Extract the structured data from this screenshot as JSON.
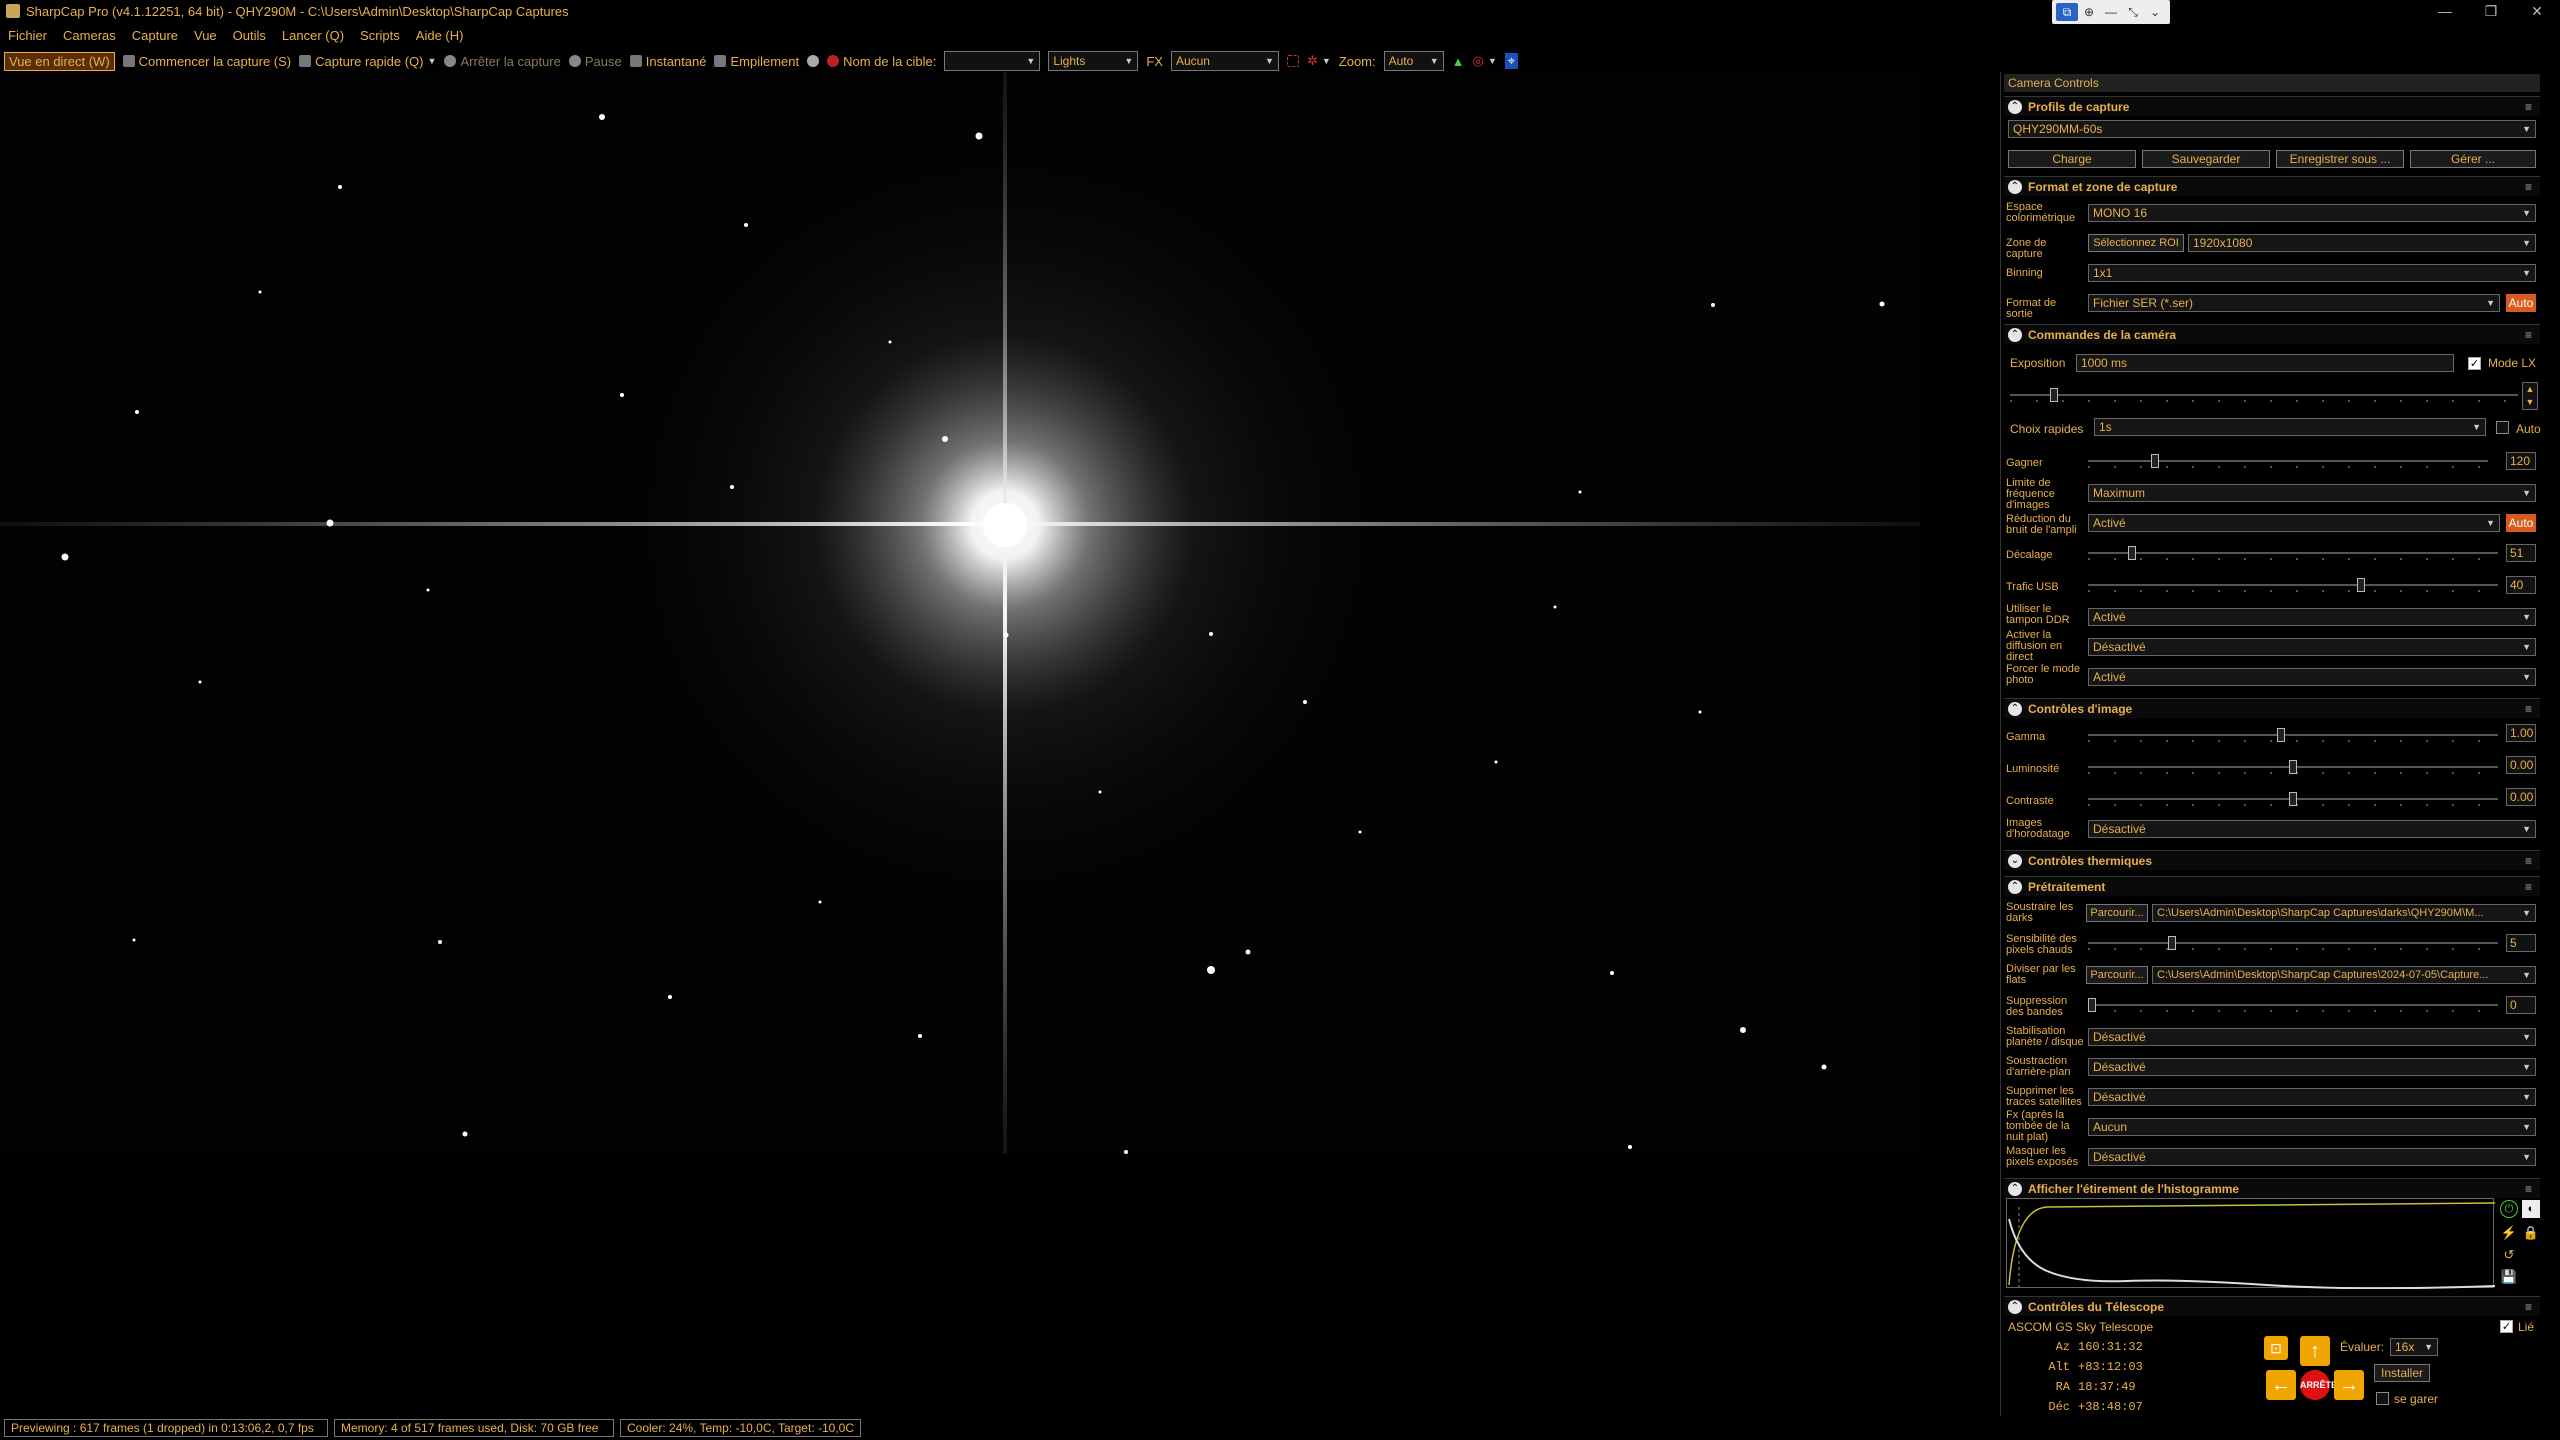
{
  "window": {
    "title": "SharpCap Pro (v4.1.12251, 64 bit) - QHY290M - C:\\Users\\Admin\\Desktop\\SharpCap Captures"
  },
  "menu": [
    "Fichier",
    "Cameras",
    "Capture",
    "Vue",
    "Outils",
    "Lancer (Q)",
    "Scripts",
    "Aide (H)"
  ],
  "toolbar": {
    "live_view": "Vue en direct (W)",
    "start_capture": "Commencer la capture (S)",
    "quick_capture": "Capture rapide (Q)",
    "stop_capture": "Arrêter la capture",
    "pause": "Pause",
    "snapshot": "Instantané",
    "stacking": "Empilement",
    "target_name_label": "Nom de la cible:",
    "target_name_value": "",
    "frame_type": "Lights",
    "fx_label": "FX",
    "fx_value": "Aucun",
    "zoom_label": "Zoom:",
    "zoom_value": "Auto"
  },
  "panel": {
    "title": "Camera Controls",
    "sections": {
      "profiles": "Profils de capture",
      "format": "Format et zone de capture",
      "camera": "Commandes de la caméra",
      "image": "Contrôles d'image",
      "thermal": "Contrôles thermiques",
      "preprocess": "Prétraitement",
      "histogram": "Afficher l'étirement de l'histogramme",
      "telescope": "Contrôles du Télescope"
    },
    "profile": {
      "selected": "QHY290MM-60s",
      "buttons": [
        "Charge",
        "Sauvegarder",
        "Enregistrer sous ...",
        "Gérer ..."
      ]
    },
    "format": {
      "colorspace_label": "Espace colorimétrique",
      "colorspace_value": "MONO 16",
      "roi_label": "Zone de capture",
      "roi_button": "Sélectionnez ROI",
      "roi_value": "1920x1080",
      "binning_label": "Binning",
      "binning_value": "1x1",
      "output_label": "Format de sortie",
      "output_value": "Fichier SER (*.ser)",
      "auto": "Auto"
    },
    "camera": {
      "exposure_label": "Exposition",
      "exposure_value": "1000 ms",
      "lx_label": "Mode LX",
      "quick_label": "Choix rapides",
      "quick_value": "1s",
      "auto_label": "Auto",
      "gain_label": "Gagner",
      "gain_value": "120",
      "gain_fraction": 0.16,
      "framerate_label": "Limite de fréquence d'images",
      "framerate_value": "Maximum",
      "ampnoise_label": "Réduction du bruit de l'ampli",
      "ampnoise_value": "Activé",
      "auto": "Auto",
      "offset_label": "Décalage",
      "offset_value": "51",
      "offset_fraction": 0.1,
      "usb_label": "Trafic USB",
      "usb_value": "40",
      "usb_fraction": 0.67,
      "ddr_label": "Utiliser le tampon DDR",
      "ddr_value": "Activé",
      "stream_label": "Activer la diffusion en direct",
      "stream_value": "Désactivé",
      "photo_label": "Forcer le mode photo",
      "photo_value": "Activé"
    },
    "image": {
      "gamma_label": "Gamma",
      "gamma_value": "1.00",
      "gamma_fraction": 0.47,
      "lum_label": "Luminosité",
      "lum_value": "0.00",
      "lum_fraction": 0.5,
      "contrast_label": "Contraste",
      "contrast_value": "0.00",
      "contrast_fraction": 0.5,
      "timestamp_label": "Images d'horodatage",
      "timestamp_value": "Désactivé"
    },
    "pre": {
      "darks_label": "Soustraire les darks",
      "browse": "Parcourir...",
      "darks_path": "C:\\Users\\Admin\\Desktop\\SharpCap Captures\\darks\\QHY290M\\M...",
      "hot_label": "Sensibilité des pixels chauds",
      "hot_value": "5",
      "hot_fraction": 0.2,
      "flats_label": "Diviser par les flats",
      "flats_path": "C:\\Users\\Admin\\Desktop\\SharpCap Captures\\2024-07-05\\Capture...",
      "band_label": "Suppression des bandes",
      "band_value": "0",
      "band_fraction": 0.0,
      "stab_label": "Stabilisation planète / disque",
      "stab_value": "Désactivé",
      "bg_label": "Soustraction d'arrière-plan",
      "bg_value": "Désactivé",
      "sat_label": "Supprimer les traces satellites",
      "sat_value": "Désactivé",
      "fx_label": "Fx (après la tombée de la nuit plat)",
      "fx_value": "Aucun",
      "mask_label": "Masquer les pixels exposés",
      "mask_value": "Désactivé"
    },
    "telescope": {
      "name": "ASCOM GS Sky Telescope",
      "linked_label": "Lié",
      "coords": [
        {
          "k": "Az",
          "v": "160:31:32"
        },
        {
          "k": "Alt",
          "v": "+83:12:03"
        },
        {
          "k": "RA",
          "v": "18:37:49"
        },
        {
          "k": "Déc",
          "v": "+38:48:07"
        }
      ],
      "rate_label": "Évaluer:",
      "rate_value": "16x",
      "stop": "ARRÊTE",
      "install": "Installer",
      "park": "se garer"
    }
  },
  "status": {
    "preview": "Previewing : 617 frames (1 dropped) in 0:13:06,2, 0,7 fps",
    "memory": "Memory: 4 of 517 frames used, Disk: 70 GB free",
    "cooler": "Cooler: 24%, Temp: -10,0C, Target: -10,0C"
  },
  "colors": {
    "accent": "#e8b04a",
    "auto": "#d95a1e",
    "bg": "#000000"
  }
}
